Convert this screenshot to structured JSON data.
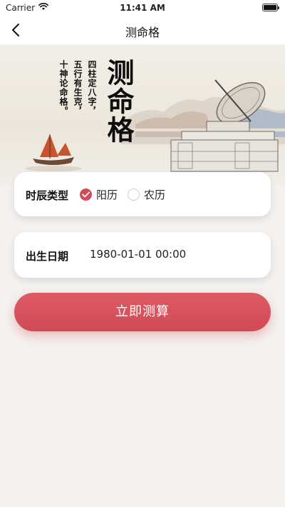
{
  "status_bar": {
    "carrier": "Carrier",
    "time": "11:41 AM",
    "wifi_icon": "wifi-icon",
    "battery_icon": "battery-icon"
  },
  "nav": {
    "title": "测命格",
    "back_icon": "chevron-left-icon"
  },
  "banner": {
    "title": "测命格",
    "poem_lines": [
      "四柱定八字，",
      "五行有生克，",
      "十神论命格。"
    ]
  },
  "form": {
    "time_type": {
      "label": "时辰类型",
      "options": [
        {
          "label": "阳历",
          "selected": true
        },
        {
          "label": "农历",
          "selected": false
        }
      ]
    },
    "birth_date": {
      "label": "出生日期",
      "value": "1980-01-01 00:00"
    }
  },
  "actions": {
    "calculate_label": "立即测算"
  },
  "colors": {
    "accent": "#d44b58",
    "background": "#f4f1ef",
    "card": "#ffffff"
  }
}
